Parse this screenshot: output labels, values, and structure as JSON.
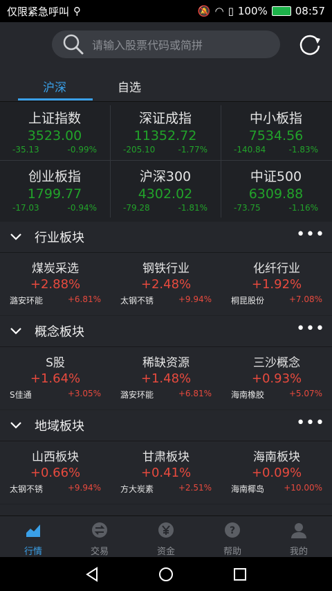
{
  "status": {
    "left": "仅限紧急呼叫",
    "battery": "100%",
    "time": "08:57"
  },
  "search": {
    "placeholder": "请输入股票代码或简拼"
  },
  "tabs": [
    {
      "label": "沪深"
    },
    {
      "label": "自选"
    }
  ],
  "indices": [
    {
      "name": "上证指数",
      "value": "3523.00",
      "chg": "-35.13",
      "pct": "-0.99%"
    },
    {
      "name": "深证成指",
      "value": "11352.72",
      "chg": "-205.10",
      "pct": "-1.77%"
    },
    {
      "name": "中小板指",
      "value": "7534.56",
      "chg": "-140.84",
      "pct": "-1.83%"
    },
    {
      "name": "创业板指",
      "value": "1799.77",
      "chg": "-17.03",
      "pct": "-0.94%"
    },
    {
      "name": "沪深300",
      "value": "4302.02",
      "chg": "-79.28",
      "pct": "-1.81%"
    },
    {
      "name": "中证500",
      "value": "6309.88",
      "chg": "-73.75",
      "pct": "-1.16%"
    }
  ],
  "sections": [
    {
      "title": "行业板块",
      "items": [
        {
          "name": "煤炭采选",
          "pct": "+2.88%",
          "stock": "潞安环能",
          "stock_pct": "+6.81%"
        },
        {
          "name": "钢铁行业",
          "pct": "+2.48%",
          "stock": "太钢不锈",
          "stock_pct": "+9.94%"
        },
        {
          "name": "化纤行业",
          "pct": "+1.92%",
          "stock": "桐昆股份",
          "stock_pct": "+7.08%"
        }
      ]
    },
    {
      "title": "概念板块",
      "items": [
        {
          "name": "S股",
          "pct": "+1.64%",
          "stock": "S佳通",
          "stock_pct": "+3.05%"
        },
        {
          "name": "稀缺资源",
          "pct": "+1.48%",
          "stock": "潞安环能",
          "stock_pct": "+6.81%"
        },
        {
          "name": "三沙概念",
          "pct": "+0.93%",
          "stock": "海南橡胶",
          "stock_pct": "+5.07%"
        }
      ]
    },
    {
      "title": "地域板块",
      "items": [
        {
          "name": "山西板块",
          "pct": "+0.66%",
          "stock": "太钢不锈",
          "stock_pct": "+9.94%"
        },
        {
          "name": "甘肃板块",
          "pct": "+0.41%",
          "stock": "方大炭素",
          "stock_pct": "+2.51%"
        },
        {
          "name": "海南板块",
          "pct": "+0.09%",
          "stock": "海南椰岛",
          "stock_pct": "+10.00%"
        }
      ]
    }
  ],
  "nav": [
    {
      "label": "行情"
    },
    {
      "label": "交易"
    },
    {
      "label": "资金"
    },
    {
      "label": "帮助"
    },
    {
      "label": "我的"
    }
  ],
  "colors": {
    "up": "#e84a3e",
    "down": "#22a32a",
    "accent": "#3aa0e8"
  }
}
